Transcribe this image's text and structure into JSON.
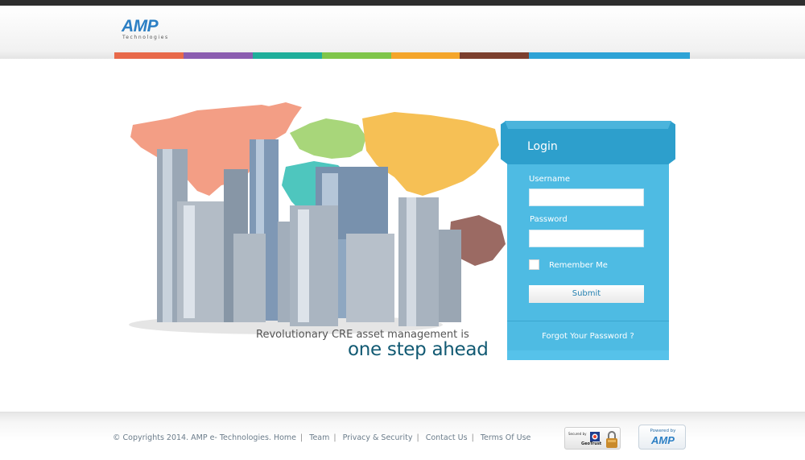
{
  "brand": {
    "logo_text": "AMP",
    "logo_sub": "Technologies",
    "color": "#2c7fc4"
  },
  "colorbar": [
    "#e8694a",
    "#8b5db0",
    "#1fae9a",
    "#7fc54a",
    "#f4a52a",
    "#7b3f2e",
    "#2ea3d6"
  ],
  "hero": {
    "tagline_line1": "Revolutionary CRE asset management is",
    "tagline_line2": "one step ahead"
  },
  "login": {
    "title": "Login",
    "username_label": "Username",
    "username_value": "",
    "password_label": "Password",
    "password_value": "",
    "remember_label": "Remember Me",
    "remember_checked": false,
    "submit_label": "Submit",
    "forgot_label": "Forgot Your Password ?",
    "panel_color": "#4ebbe3",
    "header_color": "#2d9fcc"
  },
  "footer": {
    "copyright": "© Copyrights 2014. AMP e- Technologies.",
    "links": [
      "Home",
      "Team",
      "Privacy & Security",
      "Contact Us",
      "Terms Of Use"
    ],
    "geotrust_top": "Secured by",
    "geotrust_name": "GeoTrust",
    "powered_label": "Powered by",
    "powered_logo": "AMP"
  }
}
